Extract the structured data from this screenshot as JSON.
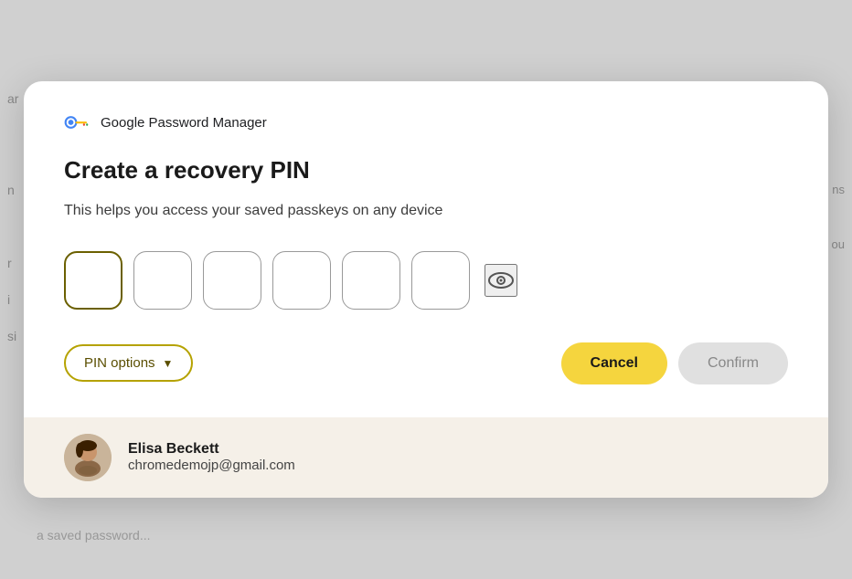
{
  "dialog": {
    "header": {
      "app_name": "Google Password Manager",
      "logo_alt": "Google Password Manager logo"
    },
    "heading": "Create a recovery PIN",
    "subtext": "This helps you access your saved passkeys on any device",
    "pin": {
      "boxes": [
        "",
        "",
        "",
        "",
        "",
        ""
      ],
      "show_password_label": "Show/hide PIN",
      "count": 6
    },
    "actions": {
      "pin_options_label": "PIN options",
      "cancel_label": "Cancel",
      "confirm_label": "Confirm",
      "chevron": "▼"
    }
  },
  "footer": {
    "user": {
      "name": "Elisa Beckett",
      "email": "chromedemojp@gmail.com",
      "avatar_alt": "Elisa Beckett avatar"
    }
  },
  "background": {
    "left_texts": [
      "ar",
      "n",
      "r",
      "i",
      "si"
    ],
    "right_texts": [
      "ns",
      "ou"
    ],
    "bottom_text": "a saved password..."
  }
}
